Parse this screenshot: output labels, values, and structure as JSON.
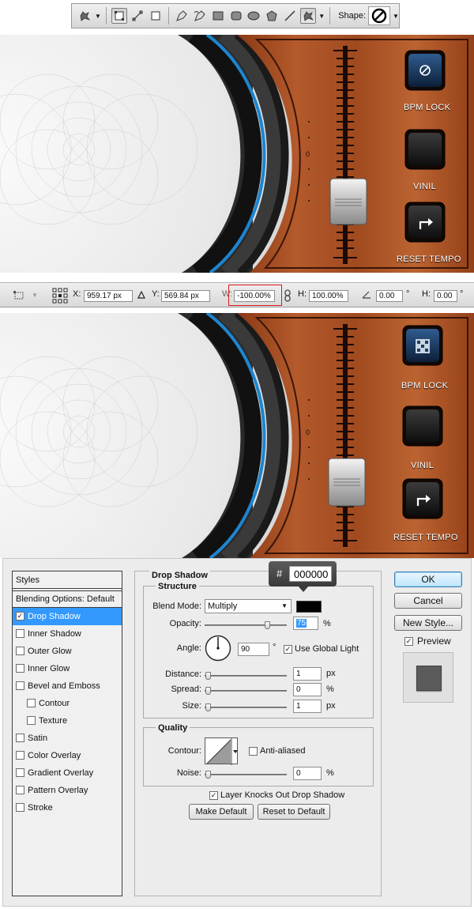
{
  "shape_toolbar": {
    "shape_label": "Shape:",
    "icons": [
      "custom-shape-tool-icon",
      "shape-layers-icon",
      "paths-icon",
      "fill-pixels-icon",
      "pen-icon",
      "freeform-pen-icon",
      "rectangle-icon",
      "rounded-rectangle-icon",
      "ellipse-icon",
      "polygon-icon",
      "line-icon",
      "custom-shape-icon",
      "no-symbol-shape-icon"
    ]
  },
  "dj_panel_top": {
    "buttons": [
      {
        "label": "BPM LOCK",
        "icon": "no-symbol-icon"
      },
      {
        "label": "VINIL",
        "icon": "blank"
      },
      {
        "label": "RESET TEMPO",
        "icon": "rotate-arrow-icon"
      }
    ],
    "scale_zero": "0",
    "slider_position": 0.8
  },
  "transform_bar": {
    "x_label": "X:",
    "x_value": "959.17 px",
    "y_label": "Y:",
    "y_value": "569.84 px",
    "w_label": "W:",
    "w_value": "-100.00%",
    "h_label": "H:",
    "h_value": "100.00%",
    "angle_value": "0.00",
    "angle_unit": "°",
    "h_skew_label": "H:",
    "h_skew_value": "0.00",
    "h_skew_unit": "°"
  },
  "dj_panel_bottom": {
    "buttons": [
      {
        "label": "BPM LOCK",
        "icon": "pattern-icon"
      },
      {
        "label": "VINIL",
        "icon": "blank"
      },
      {
        "label": "RESET TEMPO",
        "icon": "rotate-arrow-icon"
      }
    ],
    "scale_zero": "0",
    "slider_position": 0.8
  },
  "layer_style": {
    "styles_header": "Styles",
    "blending_options": "Blending Options: Default",
    "styles": [
      {
        "label": "Drop Shadow",
        "checked": true,
        "active": true,
        "sub": false
      },
      {
        "label": "Inner Shadow",
        "checked": false,
        "active": false,
        "sub": false
      },
      {
        "label": "Outer Glow",
        "checked": false,
        "active": false,
        "sub": false
      },
      {
        "label": "Inner Glow",
        "checked": false,
        "active": false,
        "sub": false
      },
      {
        "label": "Bevel and Emboss",
        "checked": false,
        "active": false,
        "sub": false
      },
      {
        "label": "Contour",
        "checked": false,
        "active": false,
        "sub": true
      },
      {
        "label": "Texture",
        "checked": false,
        "active": false,
        "sub": true
      },
      {
        "label": "Satin",
        "checked": false,
        "active": false,
        "sub": false
      },
      {
        "label": "Color Overlay",
        "checked": false,
        "active": false,
        "sub": false
      },
      {
        "label": "Gradient Overlay",
        "checked": false,
        "active": false,
        "sub": false
      },
      {
        "label": "Pattern Overlay",
        "checked": false,
        "active": false,
        "sub": false
      },
      {
        "label": "Stroke",
        "checked": false,
        "active": false,
        "sub": false
      }
    ],
    "section_title": "Drop Shadow",
    "structure_title": "Structure",
    "blend_mode_label": "Blend Mode:",
    "blend_mode_value": "Multiply",
    "shadow_color": "#000000",
    "opacity_label": "Opacity:",
    "opacity_value": "75",
    "opacity_unit": "%",
    "angle_label": "Angle:",
    "angle_value": "90",
    "angle_unit": "°",
    "use_global_light_label": "Use Global Light",
    "use_global_light_checked": true,
    "distance_label": "Distance:",
    "distance_value": "1",
    "distance_unit": "px",
    "spread_label": "Spread:",
    "spread_value": "0",
    "spread_unit": "%",
    "size_label": "Size:",
    "size_value": "1",
    "size_unit": "px",
    "quality_title": "Quality",
    "contour_label": "Contour:",
    "anti_aliased_label": "Anti-aliased",
    "anti_aliased_checked": false,
    "noise_label": "Noise:",
    "noise_value": "0",
    "noise_unit": "%",
    "knocks_out_label": "Layer Knocks Out Drop Shadow",
    "knocks_out_checked": true,
    "make_default_label": "Make Default",
    "reset_default_label": "Reset to Default",
    "ok_label": "OK",
    "cancel_label": "Cancel",
    "new_style_label": "New Style...",
    "preview_label": "Preview",
    "preview_checked": true,
    "hex_hash": "#",
    "hex_value": "000000"
  }
}
